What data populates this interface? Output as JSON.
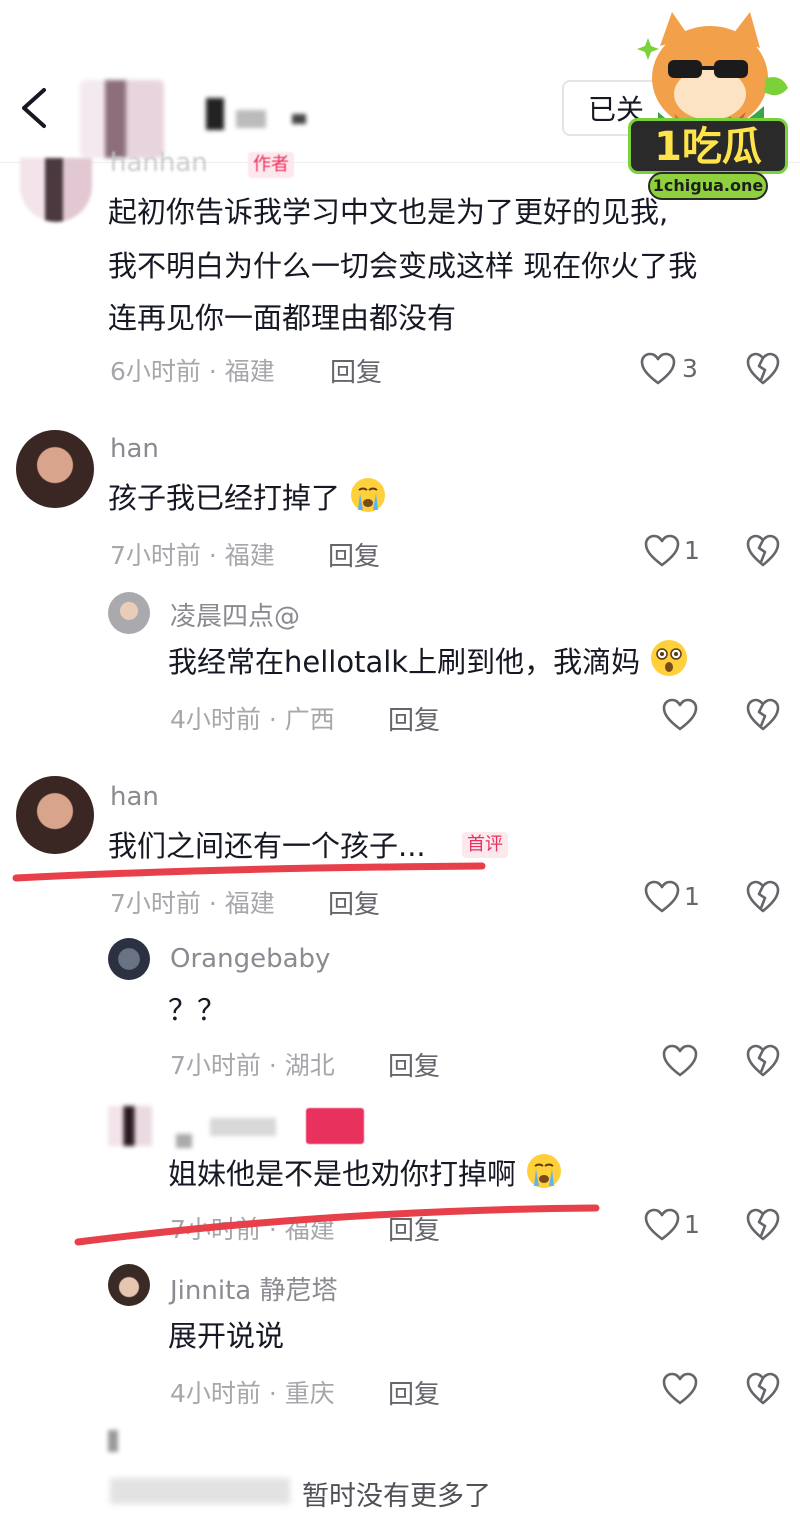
{
  "header": {
    "follow_label": "已关"
  },
  "watermark": {
    "title": "1吃瓜",
    "url": "1chigua.one"
  },
  "comments": [
    {
      "username": "hanhan",
      "badge": "作者",
      "lines": [
        "起初你告诉我学习中文也是为了更好的见我,",
        "我不明白为什么一切会变成这样 现在你火了我",
        "连再见你一面都理由都没有"
      ],
      "time": "6小时前 · 福建",
      "reply_label": "回复",
      "likes": "3"
    },
    {
      "username": "han",
      "text": "孩子我已经打掉了",
      "time": "7小时前 · 福建",
      "reply_label": "回复",
      "likes": "1"
    },
    {
      "username": "凌晨四点@",
      "text": "我经常在hellotalk上刷到他，我滴妈",
      "time": "4小时前 · 广西",
      "reply_label": "回复",
      "likes": ""
    },
    {
      "username": "han",
      "text": "我们之间还有一个孩子...",
      "badge": "首评",
      "time": "7小时前 · 福建",
      "reply_label": "回复",
      "likes": "1"
    },
    {
      "username": "Orangebaby",
      "text": "？？",
      "time": "7小时前 · 湖北",
      "reply_label": "回复",
      "likes": ""
    },
    {
      "username": "",
      "text": "姐妹他是不是也劝你打掉啊",
      "time": "7小时前 · 福建",
      "reply_label": "回复",
      "likes": "1"
    },
    {
      "username": "Jinnita 静苨塔",
      "text": "展开说说",
      "time": "4小时前 · 重庆",
      "reply_label": "回复",
      "likes": ""
    }
  ],
  "footer": {
    "no_more": "暂时没有更多了"
  },
  "colors": {
    "underline": "#e8404a",
    "badge": "#e8315d",
    "meta": "#a6a7ab"
  }
}
